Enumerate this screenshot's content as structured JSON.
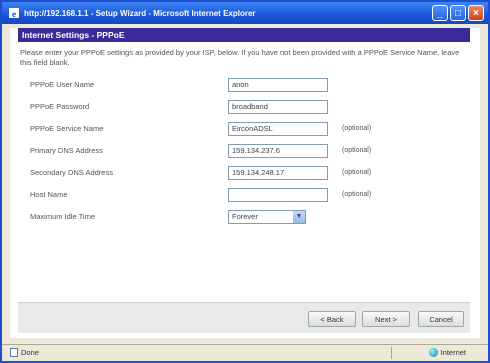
{
  "window": {
    "title": "http://192.168.1.1 - Setup Wizard - Microsoft Internet Explorer"
  },
  "section": {
    "title": "Internet Settings - PPPoE",
    "intro": "Please enter your PPPoE settings as provided by your ISP, below. If you have not been provided with a PPPoE Service Name, leave this field blank."
  },
  "fields": [
    {
      "label": "PPPoE User Name",
      "value": "anon",
      "optional": ""
    },
    {
      "label": "PPPoE Password",
      "value": "broadband",
      "optional": ""
    },
    {
      "label": "PPPoE Service Name",
      "value": "EirconADSL",
      "optional": "(optional)"
    },
    {
      "label": "Primary DNS Address",
      "value": "159.134.237.6",
      "optional": "(optional)"
    },
    {
      "label": "Secondary DNS Address",
      "value": "159.134.248.17",
      "optional": "(optional)"
    },
    {
      "label": "Host Name",
      "value": "",
      "optional": "(optional)"
    }
  ],
  "idle": {
    "label": "Maximum Idle Time",
    "selected": "Forever"
  },
  "buttons": {
    "back": "< Back",
    "next": "Next >",
    "cancel": "Cancel"
  },
  "status": {
    "left": "Done",
    "right": "Internet"
  }
}
